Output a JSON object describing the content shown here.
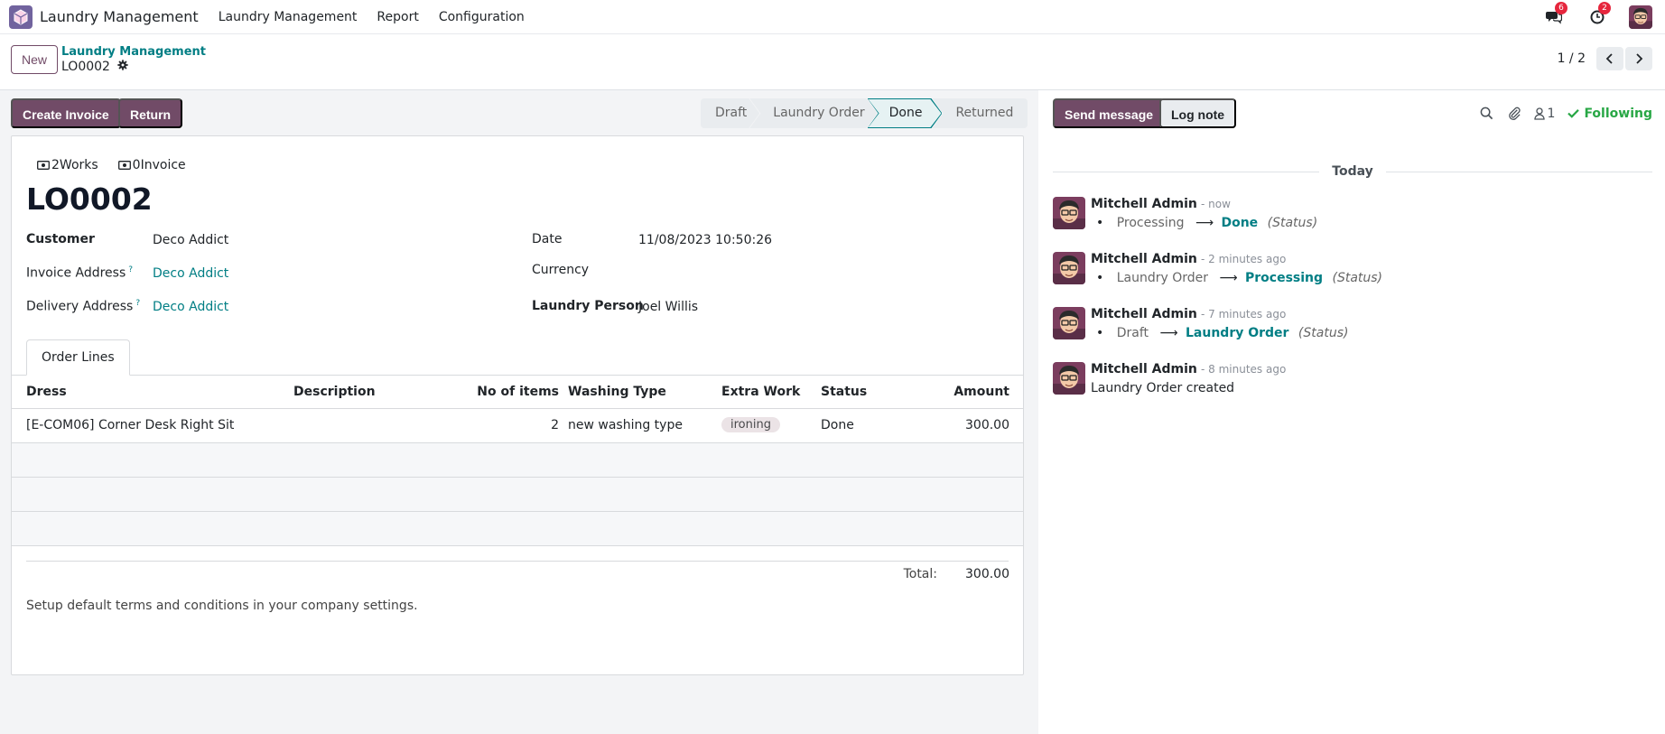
{
  "navbar": {
    "app_name": "Laundry Management",
    "menu": [
      "Laundry Management",
      "Report",
      "Configuration"
    ],
    "messages_count": "6",
    "activities_count": "2"
  },
  "control": {
    "new_label": "New",
    "breadcrumb_parent": "Laundry Management",
    "breadcrumb_current": "LO0002",
    "pager": "1 / 2"
  },
  "actions": {
    "create_invoice": "Create Invoice",
    "return": "Return"
  },
  "statusbar": {
    "stages": [
      "Draft",
      "Laundry Order",
      "Done",
      "Returned"
    ],
    "active": "Done"
  },
  "smart_buttons": {
    "works_count": "2",
    "works_label": "Works",
    "invoice_count": "0",
    "invoice_label": "Invoice"
  },
  "record": {
    "title": "LO0002",
    "customer_label": "Customer",
    "customer": "Deco Addict",
    "invoice_address_label": "Invoice Address",
    "invoice_address": "Deco Addict",
    "delivery_address_label": "Delivery Address",
    "delivery_address": "Deco Addict",
    "help_mark": "?",
    "date_label": "Date",
    "date": "11/08/2023 10:50:26",
    "currency_label": "Currency",
    "currency": "",
    "laundry_person_label": "Laundry Person",
    "laundry_person": "Joel Willis"
  },
  "tabs": {
    "order_lines": "Order Lines"
  },
  "table": {
    "headers": {
      "dress": "Dress",
      "description": "Description",
      "items": "No of items",
      "washing": "Washing Type",
      "extra": "Extra Work",
      "status": "Status",
      "amount": "Amount"
    },
    "rows": [
      {
        "dress": "[E-COM06] Corner Desk Right Sit",
        "description": "",
        "items": "2",
        "washing": "new washing type",
        "extra": "ironing",
        "status": "Done",
        "amount": "300.00"
      }
    ]
  },
  "totals": {
    "label": "Total:",
    "value": "300.00"
  },
  "terms": "Setup default terms and conditions in your company settings.",
  "chatter": {
    "send_message": "Send message",
    "log_note": "Log note",
    "followers_count": "1",
    "following": "Following",
    "today": "Today",
    "messages": [
      {
        "author": "Mitchell Admin",
        "time": "- now",
        "old": "Processing",
        "new": "Done",
        "field": "(Status)"
      },
      {
        "author": "Mitchell Admin",
        "time": "- 2 minutes ago",
        "old": "Laundry Order",
        "new": "Processing",
        "field": "(Status)"
      },
      {
        "author": "Mitchell Admin",
        "time": "- 7 minutes ago",
        "old": "Draft",
        "new": "Laundry Order",
        "field": "(Status)"
      },
      {
        "author": "Mitchell Admin",
        "time": "- 8 minutes ago",
        "body": "Laundry Order created"
      }
    ]
  },
  "icons": {
    "app": "box-icon",
    "messages": "chat-bubbles-icon",
    "activities": "clock-icon",
    "gear": "gear-icon",
    "search": "search-icon",
    "attachment": "paperclip-icon",
    "followers": "user-icon",
    "following": "check-icon"
  },
  "colors": {
    "brand": "#714b67",
    "link": "#017e84",
    "badge": "#e6263d",
    "following": "#28a745"
  }
}
